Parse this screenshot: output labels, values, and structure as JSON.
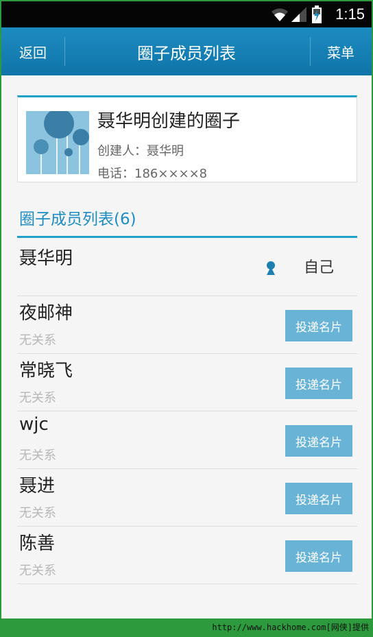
{
  "status_bar": {
    "time": "1:15",
    "wifi_icon": "wifi-icon",
    "signal_icon": "signal-icon",
    "battery_icon": "battery-charging-icon"
  },
  "action_bar": {
    "back_label": "返回",
    "title": "圈子成员列表",
    "menu_label": "菜单"
  },
  "circle": {
    "name": "聂华明创建的圈子",
    "creator": "创建人：聂华明",
    "phone": "电话：186××××8",
    "avatar_icon": "circle-avatar-image"
  },
  "members_section": {
    "title": "圈子成员列表(6)"
  },
  "members": [
    {
      "name": "聂华明",
      "self_label": "自己",
      "self_icon": "person-pin-icon"
    },
    {
      "name": "夜邮神",
      "relation": "无关系",
      "button": "投递名片"
    },
    {
      "name": "常晓飞",
      "relation": "无关系",
      "button": "投递名片"
    },
    {
      "name": "wjc",
      "relation": "无关系",
      "button": "投递名片"
    },
    {
      "name": "聂进",
      "relation": "无关系",
      "button": "投递名片"
    },
    {
      "name": "陈善",
      "relation": "无关系",
      "button": "投递名片"
    }
  ],
  "watermark": "http://www.hackhome.com[网侠]提供",
  "colors": {
    "accent": "#1d8cc1",
    "button": "#69b3d6",
    "frame": "#2e9a3e"
  }
}
